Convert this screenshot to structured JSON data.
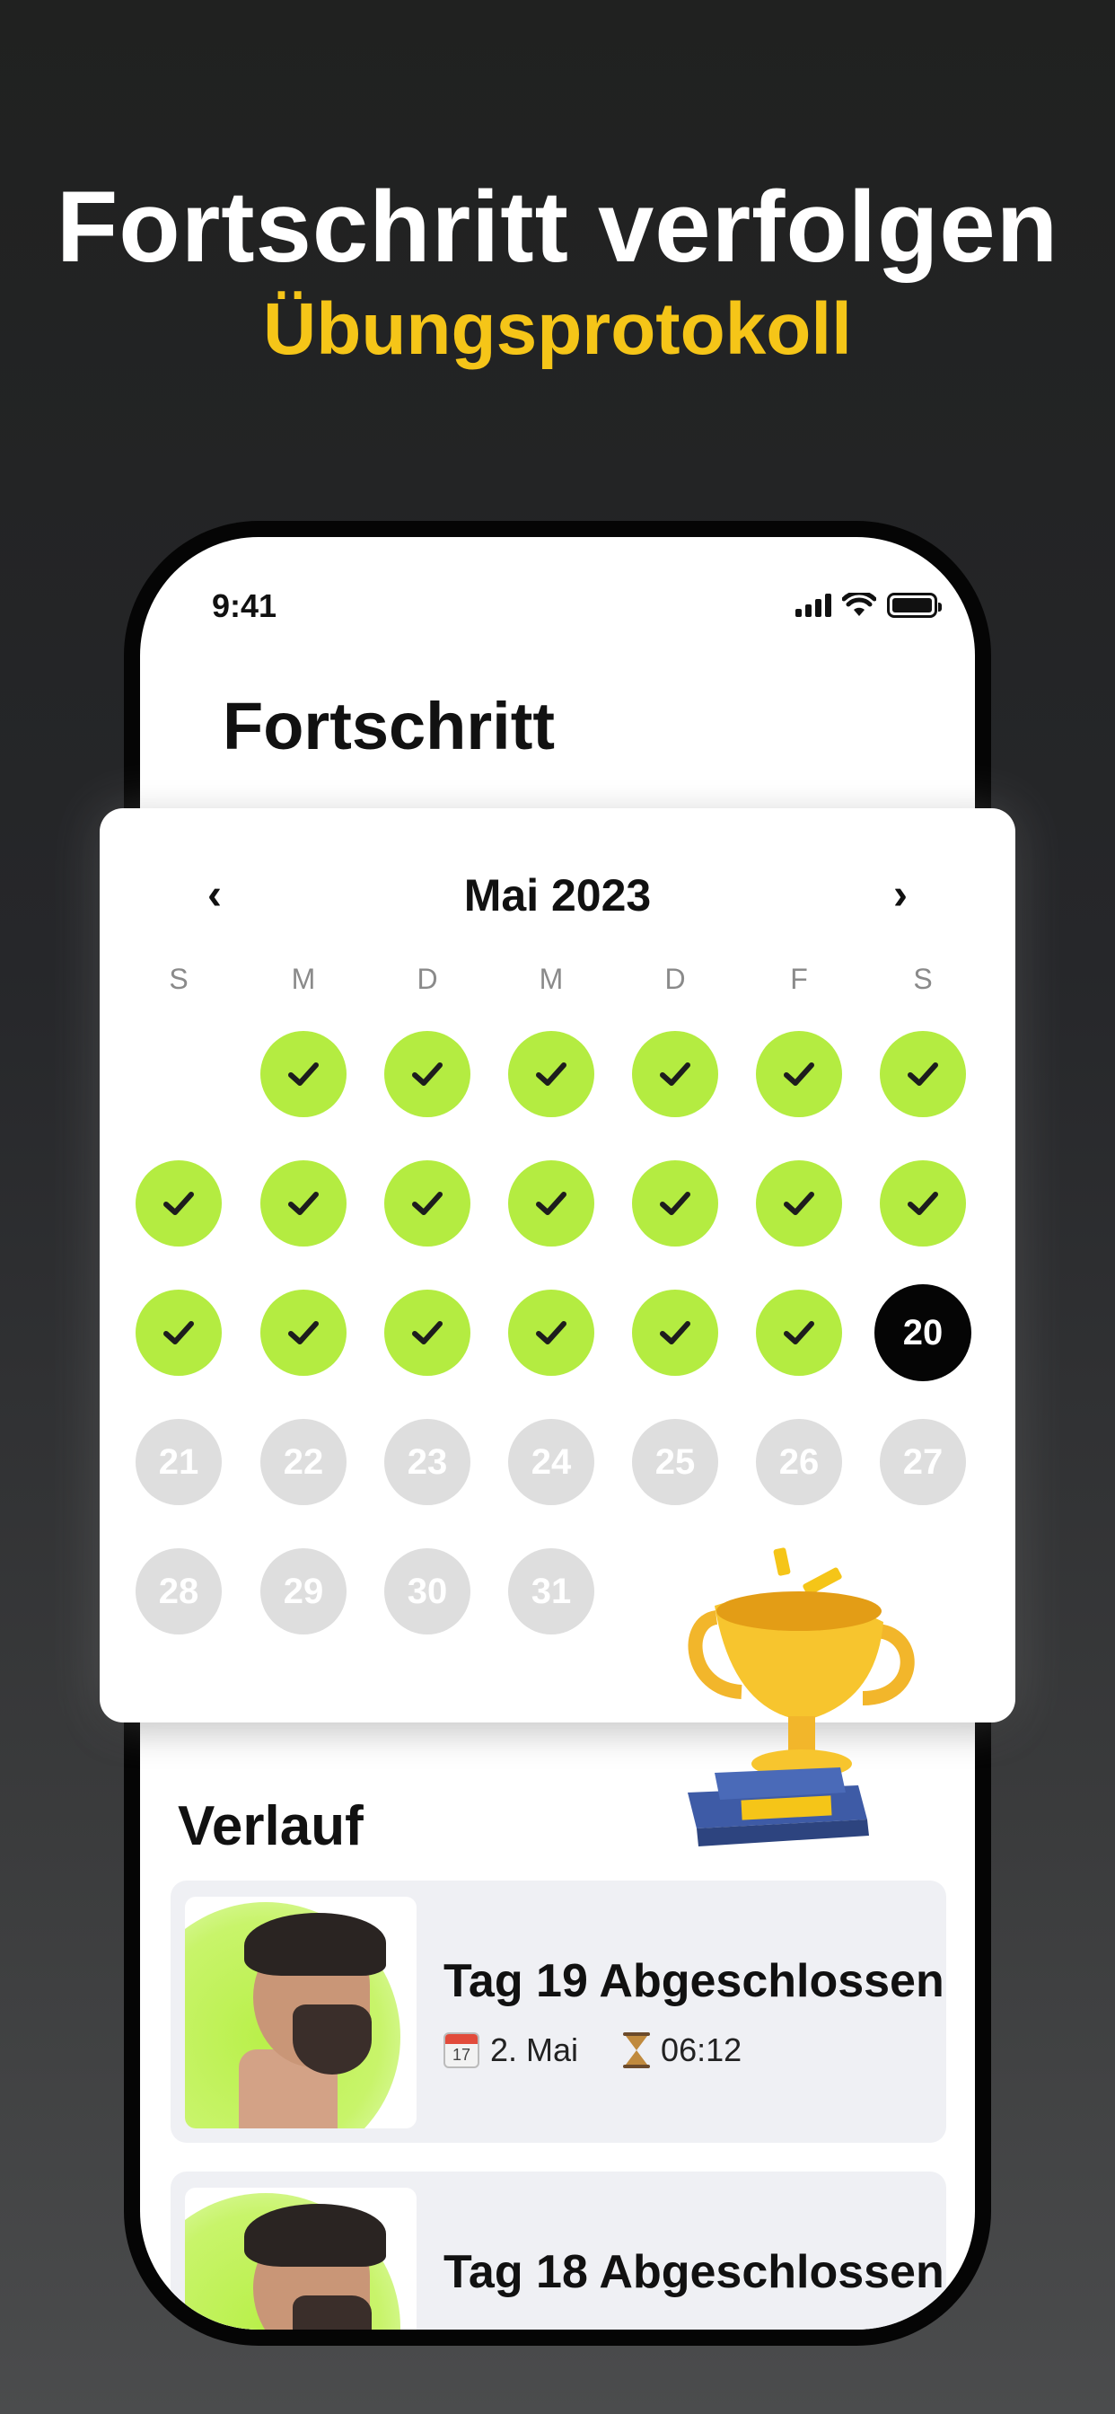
{
  "promo": {
    "headline": "Fortschritt verfolgen",
    "subline": "Übungsprotokoll"
  },
  "status_bar": {
    "time": "9:41",
    "icons": [
      "cellular-signal-icon",
      "wifi-icon",
      "battery-icon"
    ]
  },
  "page": {
    "title": "Fortschritt"
  },
  "calendar": {
    "month_label": "Mai 2023",
    "prev_icon": "‹",
    "next_icon": "›",
    "weekdays": [
      "S",
      "M",
      "D",
      "M",
      "D",
      "F",
      "S"
    ],
    "completed_days": [
      1,
      2,
      3,
      4,
      5,
      6,
      7,
      8,
      9,
      10,
      11,
      12,
      13,
      14,
      15,
      16,
      17,
      18,
      19
    ],
    "today": "20",
    "upcoming_days": [
      "21",
      "22",
      "23",
      "24",
      "25",
      "26",
      "27",
      "28",
      "29",
      "30",
      "31"
    ],
    "colors": {
      "done": "#b4ec41",
      "today": "#050505",
      "upcoming": "#dedede"
    }
  },
  "history": {
    "title": "Verlauf",
    "items": [
      {
        "label": "Tag 19 Abgeschlossen",
        "date": "2. Mai",
        "duration": "06:12",
        "calendar_icon_text": "17"
      },
      {
        "label": "Tag 18 Abgeschlossen",
        "date": "",
        "duration": "",
        "calendar_icon_text": ""
      }
    ]
  },
  "colors": {
    "accent_yellow": "#f5c518",
    "accent_green": "#b4ec41"
  }
}
